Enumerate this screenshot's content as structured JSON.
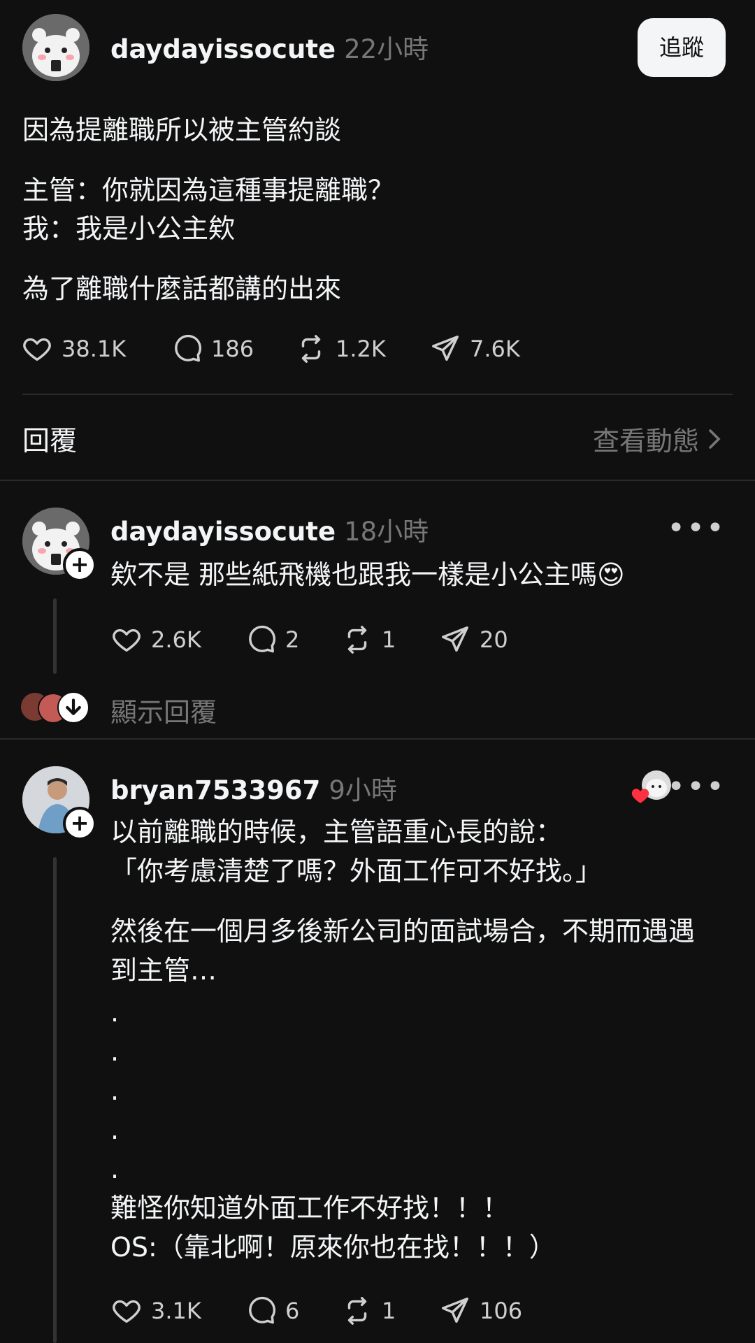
{
  "post": {
    "username": "daydayissocute",
    "time": "22小時",
    "follow_label": "追蹤",
    "lines": [
      "因為提離職所以被主管約談",
      "主管：你就因為這種事提離職？",
      "我：我是小公主欸",
      "為了離職什麼話都講的出來"
    ],
    "stats": {
      "likes": "38.1K",
      "comments": "186",
      "reposts": "1.2K",
      "shares": "7.6K"
    }
  },
  "replies_header": {
    "label": "回覆",
    "view_activity": "查看動態"
  },
  "reply1": {
    "username": "daydayissocute",
    "time": "18小時",
    "text": "欸不是 那些紙飛機也跟我一樣是小公主嗎😍",
    "stats": {
      "likes": "2.6K",
      "comments": "2",
      "reposts": "1",
      "shares": "20"
    },
    "show_replies": "顯示回覆"
  },
  "reply2": {
    "username": "bryan7533967",
    "time": "9小時",
    "lines": [
      "以前離職的時候，主管語重心長的說：",
      "「你考慮清楚了嗎？外面工作可不好找。」",
      "然後在一個月多後新公司的面試場合，不期而遇遇",
      "到主管…",
      ".",
      ".",
      ".",
      ".",
      ".",
      "難怪你知道外面工作不好找！！！",
      "OS:（靠北啊！原來你也在找！！！）"
    ],
    "stats": {
      "likes": "3.1K",
      "comments": "6",
      "reposts": "1",
      "shares": "106"
    }
  },
  "icons": {
    "like": "heart-icon",
    "comment": "comment-bubble-icon",
    "repost": "repost-icon",
    "share": "send-icon",
    "more": "more-dots-icon"
  }
}
